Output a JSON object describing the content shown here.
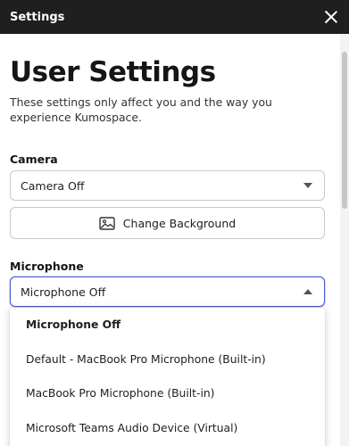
{
  "window": {
    "title": "Settings",
    "close_icon": "close-icon"
  },
  "page": {
    "title": "User Settings",
    "intro": "These settings only affect you and the way you experience Kumospace."
  },
  "camera": {
    "label": "Camera",
    "selected": "Camera Off",
    "change_background_label": "Change Background",
    "change_background_icon": "image-icon"
  },
  "microphone": {
    "label": "Microphone",
    "selected": "Microphone Off",
    "options": [
      "Microphone Off",
      "Default - MacBook Pro Microphone (Built-in)",
      "MacBook Pro Microphone (Built-in)",
      "Microsoft Teams Audio Device (Virtual)"
    ]
  },
  "colors": {
    "titlebar_bg": "#1f1f1f",
    "focus_ring": "#4b5fd1"
  }
}
